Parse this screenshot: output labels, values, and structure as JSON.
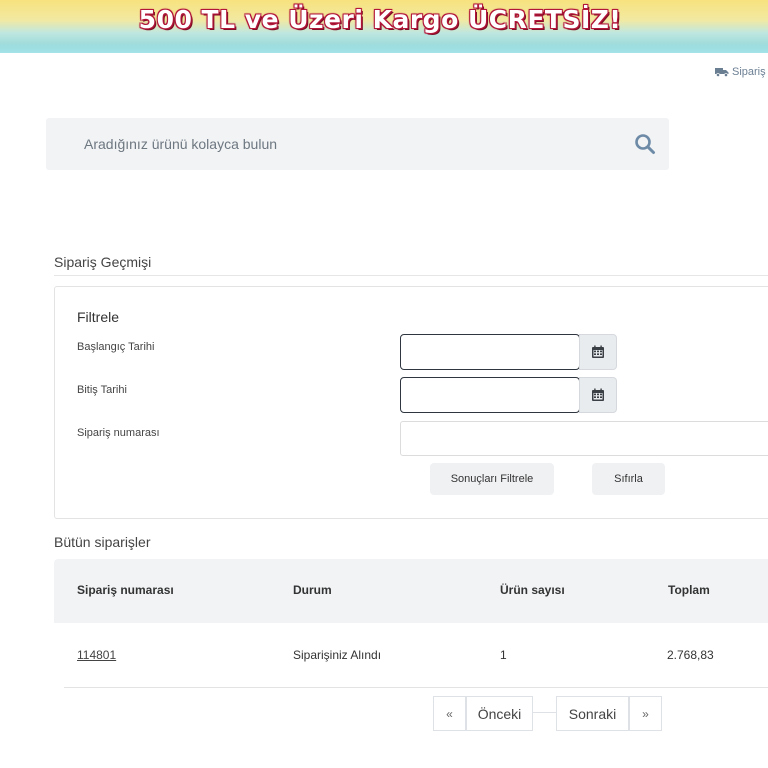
{
  "banner": {
    "text": "500 TL ve Üzeri Kargo ÜCRETSİZ!"
  },
  "header": {
    "track_link_label": "Sipariş T"
  },
  "search": {
    "placeholder": "Aradığınız ürünü kolayca bulun",
    "value": ""
  },
  "order_history": {
    "title": "Sipariş Geçmişi",
    "filter": {
      "title": "Filtrele",
      "start_date_label": "Başlangıç Tarihi",
      "end_date_label": "Bitiş Tarihi",
      "order_number_label": "Sipariş numarası",
      "start_date_value": "",
      "end_date_value": "",
      "order_number_value": "",
      "apply_button": "Sonuçları Filtrele",
      "reset_button": "Sıfırla"
    }
  },
  "orders": {
    "title": "Bütün siparişler",
    "columns": [
      "Sipariş numarası",
      "Durum",
      "Ürün sayısı",
      "Toplam"
    ],
    "rows": [
      {
        "order_number": "114801",
        "status": "Siparişiniz Alındı",
        "item_count": "1",
        "total": "2.768,83"
      }
    ]
  },
  "pagination": {
    "first": "«",
    "prev": "Önceki",
    "next": "Sonraki",
    "last": "»"
  },
  "icons": {
    "truck": "truck-icon",
    "search": "search-icon",
    "calendar": "calendar-icon"
  },
  "colors": {
    "banner_text": "#ffffff",
    "banner_outline": "#b3173a",
    "search_icon": "#6d8aa6",
    "input_border_active": "#2f3640"
  }
}
